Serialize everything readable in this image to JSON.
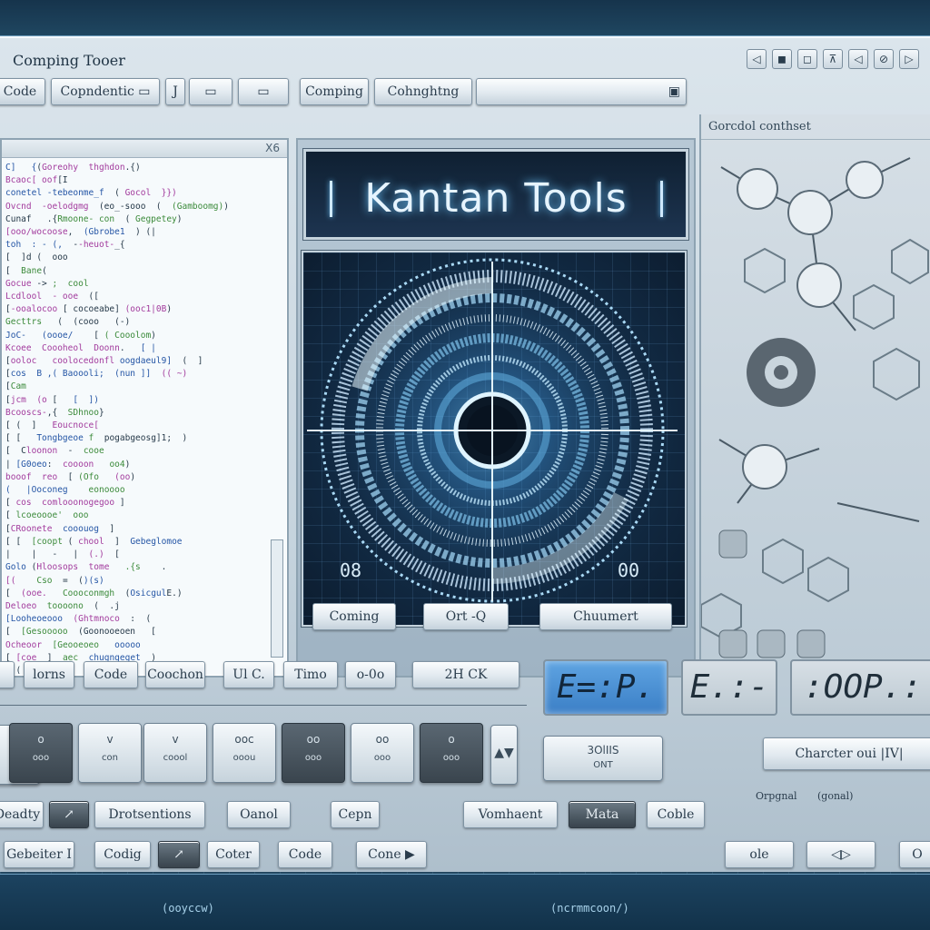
{
  "window": {
    "title": "Comping Tooer"
  },
  "window_controls": [
    "◁",
    "◼",
    "◻",
    "⊼",
    "◁",
    "⊘",
    "▷"
  ],
  "toolbar": {
    "left": [
      "Code",
      "Copndentic ▭",
      "J",
      "▭",
      "▭"
    ],
    "center": [
      "Comping",
      "Cohnghtng"
    ],
    "center_close": "▣",
    "right_label": "Gorcdol  conthset"
  },
  "code_panel": {
    "corner": "X6"
  },
  "banner": {
    "title": "Kantan  Tools"
  },
  "display": {
    "left_readout": "08",
    "right_readout": "00"
  },
  "center_buttons": [
    "Coming",
    "Ort -Q",
    "Chuumert"
  ],
  "lower_row1": [
    "lorns",
    "Code",
    "Coochon",
    "Ul C.",
    "Timo",
    "o-0o",
    "2H   CK"
  ],
  "lcd": {
    "blue": "E=:P.",
    "middle": "E.:-",
    "right": ":OOP.:"
  },
  "keys": [
    {
      "top": "o",
      "bottom": "ooo"
    },
    {
      "top": "v",
      "bottom": "con"
    },
    {
      "top": "v",
      "bottom": "coool"
    },
    {
      "top": "ooc",
      "bottom": "ooou"
    },
    {
      "top": "oo",
      "bottom": "ooo"
    },
    {
      "top": "oo",
      "bottom": "ooo"
    },
    {
      "top": "o",
      "bottom": "ooo"
    }
  ],
  "sound_panel": {
    "line1": "3OlIIS",
    "line2": "ONT"
  },
  "charter_button": "Charcter oui  |IV|",
  "orig_labels": [
    "Orpgnal",
    "(gonal)"
  ],
  "lower_row2": [
    "Deadty",
    "Drotsentions",
    "Oanol",
    "Cepn",
    "Vomhaent",
    "Mata",
    "Coble"
  ],
  "lower_row3": [
    "Gebeiter I",
    "Codig",
    "Coter",
    "Code",
    "Cone ▶",
    "ole",
    "◁▷",
    "O"
  ],
  "bottom_strip": [
    "(ooyccw)",
    "(ncrmmcoon/)"
  ]
}
